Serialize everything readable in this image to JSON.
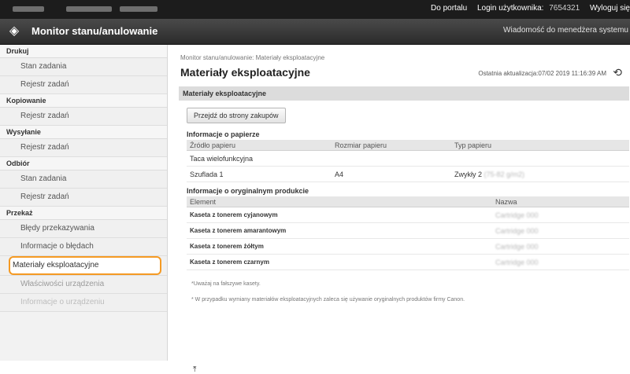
{
  "topbar": {
    "portal": "Do portalu",
    "login_label": "Login użytkownika:",
    "user_id": "7654321",
    "logout": "Wyloguj się"
  },
  "header": {
    "title": "Monitor stanu/anulowanie",
    "admin_message": "Wiadomość do menedżera systemu"
  },
  "sidebar": {
    "sections": [
      {
        "title": "Drukuj",
        "items": [
          "Stan zadania",
          "Rejestr zadań"
        ]
      },
      {
        "title": "Kopiowanie",
        "items": [
          "Rejestr zadań"
        ]
      },
      {
        "title": "Wysyłanie",
        "items": [
          "Rejestr zadań"
        ]
      },
      {
        "title": "Odbiór",
        "items": [
          "Stan zadania",
          "Rejestr zadań"
        ]
      },
      {
        "title": "Przekaż",
        "items": [
          "Błędy przekazywania"
        ]
      }
    ],
    "extra_items": [
      "Informacje o błędach",
      "Materiały eksploatacyjne",
      "Właściwości urządzenia",
      "Informacje o urządzeniu"
    ]
  },
  "main": {
    "breadcrumb": "Monitor stanu/anulowanie: Materiały eksploatacyjne",
    "title": "Materiały eksploatacyjne",
    "updated": "Ostatnia aktualizacja:07/02 2019 11:16:39 AM",
    "panel_title": "Materiały eksploatacyjne",
    "shop_button": "Przejdź do strony zakupów",
    "paper": {
      "heading": "Informacje o papierze",
      "columns": [
        "Źródło papieru",
        "Rozmiar papieru",
        "Typ papieru"
      ],
      "rows": [
        [
          "Taca wielofunkcyjna",
          "",
          ""
        ],
        [
          "Szuflada 1",
          "A4",
          "Zwykły 2"
        ]
      ],
      "blurred_suffix": "(75-82 g/m2)"
    },
    "products": {
      "heading": "Informacje o oryginalnym produkcie",
      "columns": [
        "Element",
        "Nazwa"
      ],
      "rows": [
        [
          "Kaseta z tonerem cyjanowym",
          "Cartridge 000"
        ],
        [
          "Kaseta z tonerem amarantowym",
          "Cartridge 000"
        ],
        [
          "Kaseta z tonerem żółtym",
          "Cartridge 000"
        ],
        [
          "Kaseta z tonerem czarnym",
          "Cartridge 000"
        ]
      ]
    },
    "note1": "*Uważaj na fałszywe kasety.",
    "note2": "* W przypadku wymiany materiałów eksploatacyjnych zaleca się używanie oryginalnych produktów firmy Canon."
  }
}
